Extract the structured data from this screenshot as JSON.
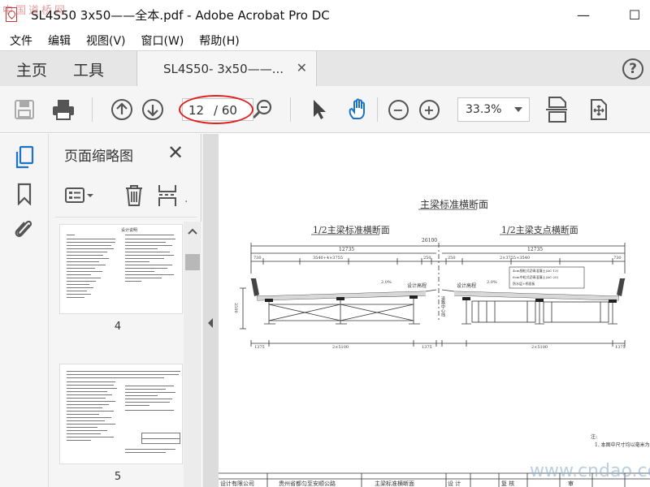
{
  "window": {
    "title": "SL4S50  3x50——全本.pdf - Adobe Acrobat Pro DC",
    "watermark_top": "中国道桥网",
    "minimize": "—",
    "maximize": "☐",
    "close": "✕"
  },
  "menu": [
    "文件",
    "编辑",
    "视图(V)",
    "窗口(W)",
    "帮助(H)"
  ],
  "tabs": {
    "home": "主页",
    "tools": "工具",
    "doc_tab": "SL4S50- 3x50——...",
    "doc_tab_close": "✕",
    "help": "?"
  },
  "toolbar": {
    "page_current": "12",
    "page_total": "/ 60",
    "zoom": "33.3%",
    "zoom_out": "−",
    "zoom_in": "+"
  },
  "panel": {
    "title": "页面缩略图",
    "close": "✕",
    "thumbnails": [
      {
        "label": "4",
        "heading": "设计说明"
      },
      {
        "label": "5"
      }
    ]
  },
  "document": {
    "main_title": "主梁标准横断面",
    "left_section": "1/2主梁标准横断面",
    "right_section": "1/2主梁支点横断面",
    "overall_width": "26100",
    "left_half": "12735",
    "right_half": "12735",
    "left_inner_dim": "3540+4×3755",
    "right_inner_dim": "2×3755+3540",
    "edge_left": "730",
    "edge_right": "730",
    "mid_dims": [
      "250",
      "250"
    ],
    "slope_left": "2.0%",
    "slope_right": "2.0%",
    "deck_label_left": "设计高程",
    "deck_label_right": "设计高程",
    "centerline": "道路中心线",
    "height_dim": "2500",
    "bottom_left": "1375",
    "bottom_mid_left": "2×5100",
    "bottom_mid_right": "1375",
    "bottom_right_mid": "2×5100",
    "bottom_right": "1375",
    "note_box": [
      "4cm细粒式沥青混凝土(AC-13)",
      "6cm中粒式沥青混凝土(AC-20)",
      "防水层+桥面板"
    ],
    "note_title": "注:",
    "note_line": "1. 本图中尺寸均以毫米为",
    "footer_company": "设计有限公司",
    "footer_project": "贵州省都匀至安顺公路",
    "footer_drawing": "主梁标准横断面",
    "footer_design": "设 计",
    "footer_review": "复 核",
    "footer_approve": "审",
    "watermark_bottom": "www.cndao.com"
  }
}
